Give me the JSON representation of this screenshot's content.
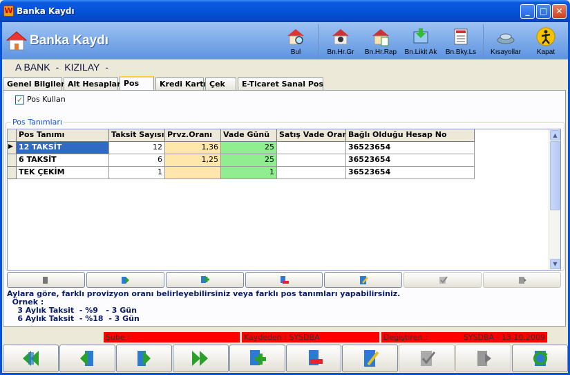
{
  "window": {
    "title": "Banka Kaydı",
    "app_letter": "W"
  },
  "header": {
    "title": "Banka Kaydı",
    "toolbar": [
      {
        "label": "Bul",
        "icon": "find-icon"
      },
      {
        "label": "Bn.Hr.Gr",
        "icon": "bank-movement-entry-icon"
      },
      {
        "label": "Bn.Hr.Rap",
        "icon": "bank-report-icon"
      },
      {
        "label": "Bn.Likit Ak",
        "icon": "liquid-flow-icon"
      },
      {
        "label": "Bn.Bky.Ls",
        "icon": "balance-list-icon"
      },
      {
        "label": "Kısayollar",
        "icon": "shortcuts-icon"
      },
      {
        "label": "Kapat",
        "icon": "close-exit-icon"
      }
    ]
  },
  "bank": {
    "name": "A BANK",
    "sep1": "-",
    "branch": "KIZILAY",
    "sep2": "-"
  },
  "tabs": [
    "Genel Bilgiler",
    "Alt Hesaplar",
    "Pos",
    "Kredi Kartı",
    "Çek",
    "E-Ticaret Sanal Pos"
  ],
  "active_tab": "Pos",
  "pos_kullan": {
    "label": "Pos Kullan",
    "checked": true
  },
  "group_label": "Pos Tanımları",
  "grid": {
    "columns": [
      "Pos Tanımı",
      "Taksit Sayısı",
      "Prvz.Oranı",
      "Vade Günü",
      "Satış Vade Oranı",
      "Bağlı Olduğu Hesap No"
    ],
    "rows": [
      {
        "pos": "12 TAKSİT",
        "taksit": "12",
        "oran": "1,36",
        "vade": "25",
        "satis": "",
        "hesap": "36523654"
      },
      {
        "pos": "6 TAKSİT",
        "taksit": "6",
        "oran": "1,25",
        "vade": "25",
        "satis": "",
        "hesap": "36523654"
      },
      {
        "pos": "TEK ÇEKİM",
        "taksit": "1",
        "oran": "",
        "vade": "1",
        "satis": "",
        "hesap": "36523654"
      }
    ]
  },
  "info": {
    "line1": "Aylara göre, farklı provizyon oranı belirleyebilirsiniz veya farklı pos tanımları yapabilirsiniz.",
    "line2": "  Örnek :",
    "line3": "    3 Aylık Taksit  - %9   - 3 Gün",
    "line4": "    6 Aylık Taksit  - %18  - 3 Gün"
  },
  "status": {
    "sube": "Şube :",
    "kaydeden": "Kaydeden : SYSDBA",
    "degistiren_label": "Değiştiren :",
    "degistiren_value": "SYSDBA  - 13.10.2009"
  },
  "colors": {
    "accent": "#0553d6",
    "peach": "#ffe6aa",
    "green": "#90ee90",
    "status_red": "#ff0000"
  }
}
